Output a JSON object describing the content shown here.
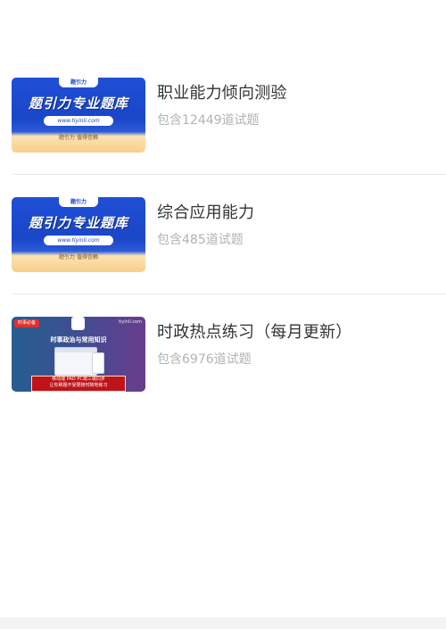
{
  "items": [
    {
      "title": "职业能力倾向测验",
      "count_text": "包含12449道试题",
      "thumb": {
        "logo": "题引力",
        "headline": "题引力专业题库",
        "url": "www.tiyinli.com",
        "slogan": "题引力 值得信赖"
      }
    },
    {
      "title": "综合应用能力",
      "count_text": "包含485道试题",
      "thumb": {
        "logo": "题引力",
        "headline": "题引力专业题库",
        "url": "www.tiyinli.com",
        "slogan": "题引力 值得信赖"
      }
    },
    {
      "title": "时政热点练习（每月更新）",
      "count_text": "包含6976道试题",
      "thumb": {
        "tag": "时事必备",
        "brand": "tiyinli.com",
        "headline": "时事政治与常用知识",
        "redbox_line1": "移动端 PAD PC端三端同步",
        "redbox_line2": "让你刷题不受限随时随地练习"
      }
    }
  ],
  "colors": {
    "title": "#333333",
    "subtitle": "#b3b3b3",
    "divider": "#eaeaea",
    "brand_blue": "#1a46c8"
  }
}
